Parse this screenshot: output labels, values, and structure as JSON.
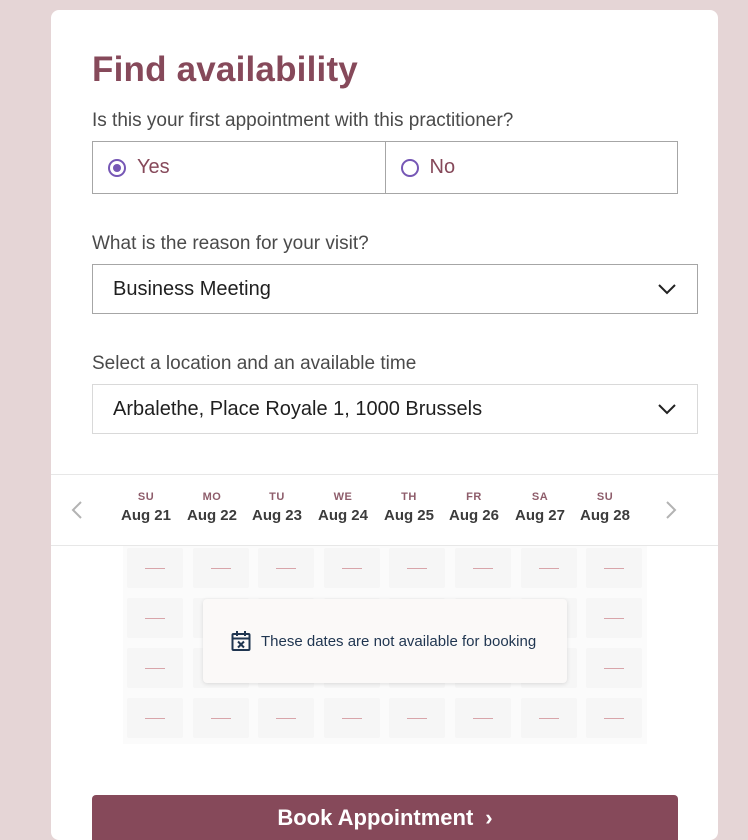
{
  "title": "Find availability",
  "first_appointment": {
    "question": "Is this your first appointment with this practitioner?",
    "options": [
      {
        "label": "Yes",
        "selected": true
      },
      {
        "label": "No",
        "selected": false
      }
    ]
  },
  "reason": {
    "label": "What is the reason for your visit?",
    "value": "Business Meeting"
  },
  "location": {
    "label": "Select a location and an available time",
    "value": "Arbalethe, Place Royale 1, 1000 Brussels"
  },
  "calendar": {
    "days": [
      {
        "abbr": "SU",
        "date": "Aug 21"
      },
      {
        "abbr": "MO",
        "date": "Aug 22"
      },
      {
        "abbr": "TU",
        "date": "Aug 23"
      },
      {
        "abbr": "WE",
        "date": "Aug 24"
      },
      {
        "abbr": "TH",
        "date": "Aug 25"
      },
      {
        "abbr": "FR",
        "date": "Aug 26"
      },
      {
        "abbr": "SA",
        "date": "Aug 27"
      },
      {
        "abbr": "SU",
        "date": "Aug 28"
      }
    ],
    "notice": "These dates are not available for booking",
    "notice_icon": "calendar-x-icon"
  },
  "book_button": {
    "label": "Book Appointment"
  },
  "colors": {
    "brand": "#86495a",
    "radio_accent": "#7657b5",
    "background": "#e5d5d6",
    "notice_text": "#1f3550",
    "slot_dash": "#d8a5aa"
  }
}
